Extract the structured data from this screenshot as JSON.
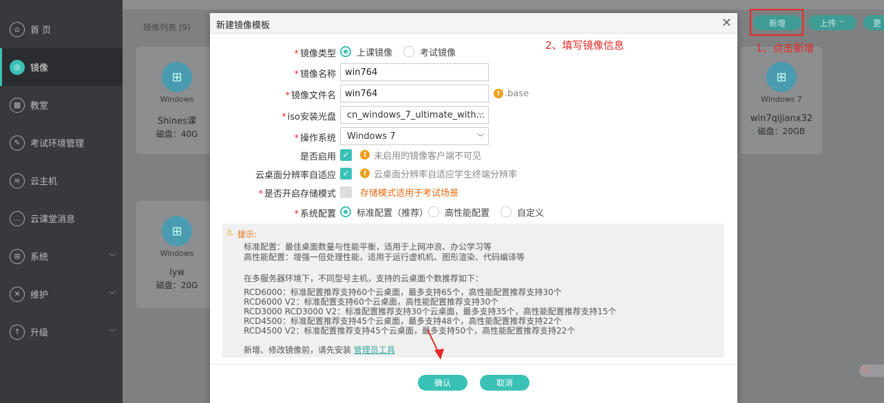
{
  "sidebar": {
    "items": [
      {
        "label": "首 页",
        "icon": "home-icon",
        "glyph": "⌂"
      },
      {
        "label": "镜像",
        "icon": "image-icon",
        "glyph": "◎"
      },
      {
        "label": "教室",
        "icon": "classroom-icon",
        "glyph": "▦"
      },
      {
        "label": "考试环境管理",
        "icon": "exam-icon",
        "glyph": "✎"
      },
      {
        "label": "云主机",
        "icon": "host-icon",
        "glyph": "≡"
      },
      {
        "label": "云课堂消息",
        "icon": "message-icon",
        "glyph": "…"
      },
      {
        "label": "系统",
        "icon": "system-icon",
        "glyph": "⊞"
      },
      {
        "label": "维护",
        "icon": "maintain-icon",
        "glyph": "✕"
      },
      {
        "label": "升级",
        "icon": "upgrade-icon",
        "glyph": "↑"
      }
    ],
    "active_index": 1
  },
  "main": {
    "list_title": "镜像列表 (9)",
    "cards": [
      {
        "os": "Windows",
        "name": "Shines课",
        "disk": "磁盘：40G"
      },
      {
        "os": "Windows 7",
        "name": "win7qijianx32",
        "disk": "磁盘：20GB"
      },
      {
        "os": "Windows",
        "name": "lyw",
        "disk": "磁盘：20G"
      }
    ],
    "toolbar": {
      "add": "新增",
      "upload": "上传",
      "more": "更"
    }
  },
  "annotations": {
    "step1": "1、点击新增",
    "step2": "2、填写镜像信息"
  },
  "modal": {
    "title": "新建镜像模板",
    "fields": {
      "image_type": {
        "label": "镜像类型",
        "options": [
          "上课镜像",
          "考试镜像"
        ],
        "selected": 0
      },
      "image_name": {
        "label": "镜像名称",
        "value": "win764"
      },
      "file_name": {
        "label": "镜像文件名",
        "value": "win764",
        "suffix": ".base"
      },
      "iso": {
        "label": "iso安装光盘",
        "value": "cn_windows_7_ultimate_with..."
      },
      "os": {
        "label": "操作系统",
        "value": "Windows 7"
      },
      "enabled": {
        "label": "是否启用",
        "checked": true,
        "hint": "未启用的镜像客户端不可见"
      },
      "adaptive": {
        "label": "云桌面分辨率自适应",
        "checked": true,
        "hint": "云桌面分辨率自适应学生终端分辨率"
      },
      "storage": {
        "label": "是否开启存储模式",
        "checked": false,
        "hint": "存储模式适用于考试场景"
      },
      "config": {
        "label": "系统配置",
        "options": [
          "标准配置（推荐）",
          "高性能配置",
          "自定义"
        ],
        "selected": 0
      }
    },
    "tips": {
      "title": "提示:",
      "lines": [
        "标准配置：最佳桌面数量与性能平衡，适用于上网冲浪、办公学习等",
        "高性能配置：增强一倍处理性能，适用于运行虚机机、图形渲染、代码编译等",
        "在多服务器环境下，不同型号主机，支持的云桌面个数推荐如下：",
        "RCD6000：标准配置推荐支持60个云桌面，最多支持65个，高性能配置推荐支持30个",
        "RCD6000 V2：标准配置支持60个云桌面，高性能配置推荐支持30个",
        "RCD3000 RCD3000 V2：标准配置推荐支持30个云桌面，最多支持35个，高性能配置推荐支持15个",
        "RCD4500：标准配置推荐支持45个云桌面，最多支持48个，高性能配置推荐支持22个",
        "RCD4500 V2：标准配置推荐支持45个云桌面，最多支持50个，高性能配置推荐支持22个"
      ],
      "install_prefix": "新增、修改镜像前，请先安装",
      "install_link": "管理员工具"
    },
    "buttons": {
      "confirm": "确认",
      "cancel": "取消"
    }
  },
  "corner_chip": "管",
  "colors": {
    "accent": "#39c1b6",
    "annotation_red": "#e42a25",
    "warning_orange": "#e86a10"
  }
}
